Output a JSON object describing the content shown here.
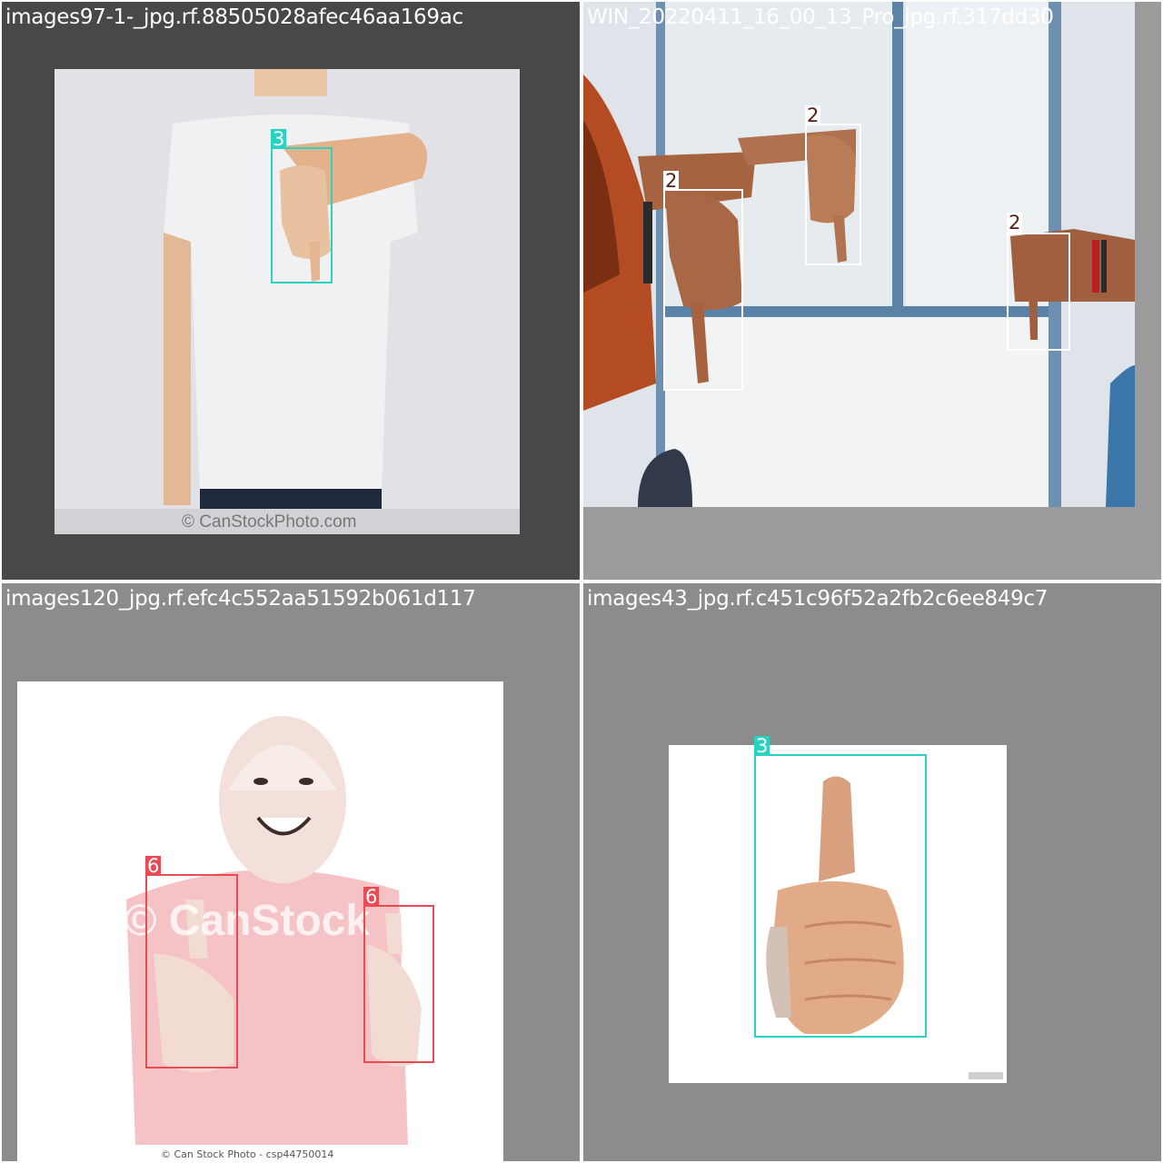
{
  "tiles": [
    {
      "filename": "images97-1-_jpg.rf.88505028afec46aa169ac",
      "watermark": "© CanStockPhoto.com",
      "boxes": [
        {
          "class_id": "3",
          "color": "#2ad3c0",
          "label_text_color": "#ffffff"
        }
      ]
    },
    {
      "filename": "WIN_20220411_16_00_13_Pro_jpg.rf.317dd30",
      "boxes": [
        {
          "class_id": "2",
          "color": "#ffffff",
          "label_text_color": "#5a1d12"
        },
        {
          "class_id": "2",
          "color": "#ffffff",
          "label_text_color": "#5a1d12"
        },
        {
          "class_id": "2",
          "color": "#ffffff",
          "label_text_color": "#5a1d12"
        }
      ]
    },
    {
      "filename": "images120_jpg.rf.efc4c552aa51592b061d117",
      "watermark": "© CanStock",
      "footer": "© Can Stock Photo - csp44750014",
      "boxes": [
        {
          "class_id": "6",
          "color": "#e94a53",
          "label_text_color": "#ffffff"
        },
        {
          "class_id": "6",
          "color": "#e94a53",
          "label_text_color": "#ffffff"
        }
      ]
    },
    {
      "filename": "images43_jpg.rf.c451c96f52a2fb2c6ee849c7",
      "boxes": [
        {
          "class_id": "3",
          "color": "#2ad3c0",
          "label_text_color": "#ffffff"
        }
      ]
    }
  ]
}
